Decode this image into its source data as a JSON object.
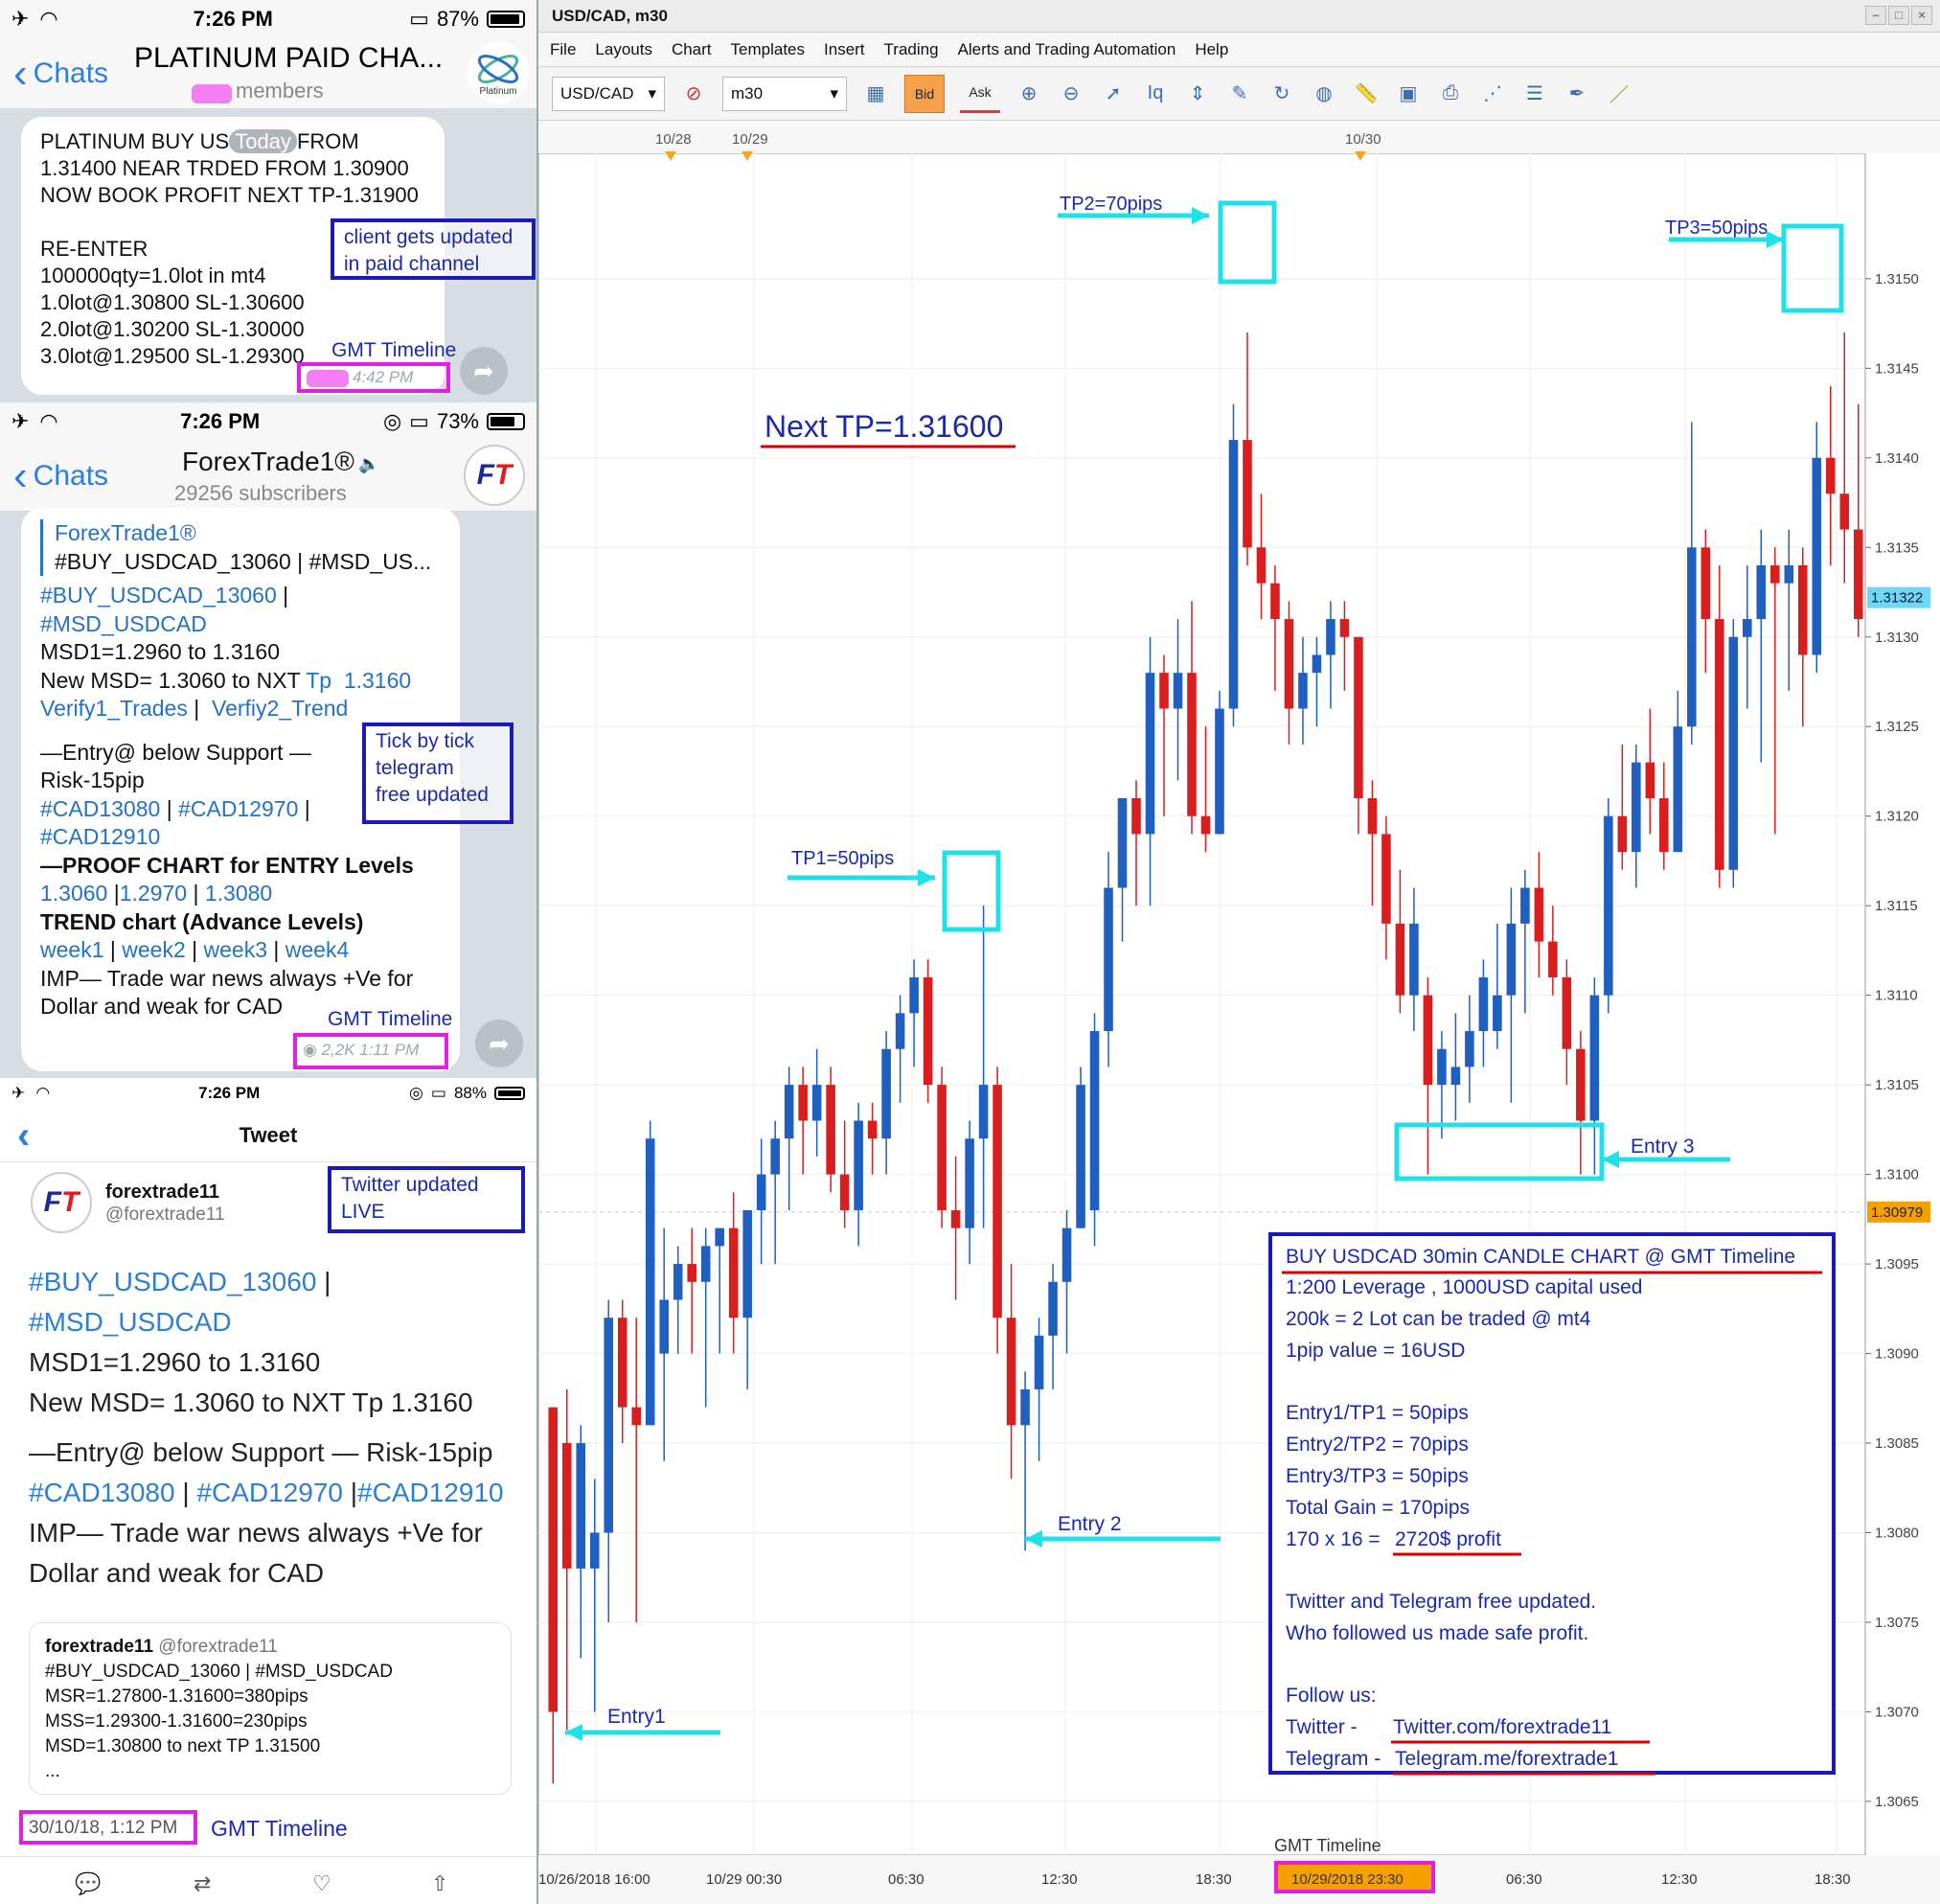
{
  "phone1": {
    "status": {
      "time": "7:26 PM",
      "battery": "87%",
      "battery_frac": 0.87
    },
    "back_label": "Chats",
    "title": "PLATINUM PAID CHA...",
    "subtitle": "members",
    "today": "Today",
    "message": {
      "line1": "PLATINUM BUY US",
      "line1b": "FROM",
      "line2": "1.31400 NEAR TRDED FROM 1.30900",
      "line3": "NOW BOOK PROFIT NEXT TP-1.31900",
      "line4": "RE-ENTER",
      "line5": "100000qty=1.0lot in mt4",
      "line6": "1.0lot@1.30800 SL-1.30600",
      "line7": "2.0lot@1.30200 SL-1.30000",
      "line8": "3.0lot@1.29500 SL-1.29300",
      "time": "4:42 PM"
    },
    "annot_box": "client gets updated in paid channel",
    "annot_box_l1": "client gets updated",
    "annot_box_l2": "in paid channel",
    "gmt": "GMT Timeline"
  },
  "phone2": {
    "status": {
      "time": "7:26 PM",
      "battery": "73%",
      "battery_frac": 0.73
    },
    "back_label": "Chats",
    "title": "ForexTrade1®",
    "subtitle": "29256 subscribers",
    "logo": "FT",
    "msg": {
      "sender": "ForexTrade1®",
      "quote": "#BUY_USDCAD_13060 | #MSD_US...",
      "l1": "#BUY_USDCAD_13060",
      "l1sep": " |",
      "l2": "#MSD_USDCAD",
      "l3": "MSD1=1.2960 to 1.3160",
      "l4a": "New MSD= 1.3060 to NXT ",
      "l4b": "Tp  1.3160",
      "l5a": "Verify1_Trades",
      "l5sep": " |  ",
      "l5b": "Verfiy2_Trend",
      "l6": "—Entry@ below Support —",
      "l7": "Risk-15pip",
      "l8a": "#CAD13080",
      "l8sep1": " | ",
      "l8b": "#CAD12970",
      "l8sep2": " |",
      "l9": "#CAD12910",
      "l10": "—PROOF CHART for ENTRY Levels",
      "l11a": "1.3060",
      "l11sep1": " |",
      "l11b": "1.2970",
      "l11sep2": " | ",
      "l11c": "1.3080",
      "l12": "TREND chart (Advance Levels)",
      "l13a": "week1",
      "l13b": "week2",
      "l13c": "week3",
      "l13d": "week4",
      "l13sep": " | ",
      "l14": "IMP— Trade war news always +Ve for",
      "l15": "Dollar and weak for CAD",
      "views": "2,2K 1:11 PM"
    },
    "annot_box_l1": "Tick by tick",
    "annot_box_l2": "telegram",
    "annot_box_l3": "free updated",
    "gmt": "GMT Timeline"
  },
  "phone3": {
    "status": {
      "time": "7:26 PM",
      "battery": "88%",
      "battery_frac": 0.88
    },
    "header": "Tweet",
    "name": "forextrade11",
    "handle": "@forextrade11",
    "annot_box_l1": "Twitter updated",
    "annot_box_l2": "LIVE",
    "body": {
      "l1": "#BUY_USDCAD_13060",
      "l1sep": " |",
      "l2": "#MSD_USDCAD",
      "l3": "MSD1=1.2960 to 1.3160",
      "l4": "New MSD= 1.3060 to NXT Tp  1.3160",
      "l5": "—Entry@ below Support — Risk-15pip",
      "l6a": "#CAD13080",
      "l6sep1": " | ",
      "l6b": "#CAD12970",
      "l6sep2": " |",
      "l6c": "#CAD12910",
      "l7": "IMP— Trade war news always +Ve for",
      "l8": "Dollar and weak for CAD"
    },
    "quote": {
      "name": "forextrade11",
      "handle": "@forextrade11",
      "l1": "#BUY_USDCAD_13060 | #MSD_USDCAD",
      "l2": "MSR=1.27800-1.31600=380pips",
      "l3": "MSS=1.29300-1.31600=230pips",
      "l4": "MSD=1.30800 to next TP 1.31500",
      "l5": "..."
    },
    "date": "30/10/18, 1:12 PM",
    "gmt": "GMT Timeline"
  },
  "platform": {
    "title": "USD/CAD, m30",
    "menu": [
      "File",
      "Layouts",
      "Chart",
      "Templates",
      "Insert",
      "Trading",
      "Alerts and Trading Automation",
      "Help"
    ],
    "symbol": "USD/CAD",
    "timeframe": "m30",
    "bid": "Bid",
    "ask": "Ask"
  },
  "chart_data": {
    "type": "candlestick",
    "title": "",
    "xlabel": "",
    "ylabel": "",
    "ylim": [
      1.3062,
      1.3157
    ],
    "y_ticks": [
      "1.3150",
      "1.3145",
      "1.3140",
      "1.3135",
      "1.3130",
      "1.3125",
      "1.3120",
      "1.3115",
      "1.3110",
      "1.3105",
      "1.3100",
      "1.3095",
      "1.3090",
      "1.3085",
      "1.3080",
      "1.3075",
      "1.3070",
      "1.3065"
    ],
    "x_ticks": [
      "10/26/2018 16:00",
      "10/29 00:30",
      "06:30",
      "12:30",
      "18:30",
      "10/29/2018 23:30",
      "06:30",
      "12:30",
      "18:30"
    ],
    "top_dates": [
      "10/28",
      "10/29",
      "10/30"
    ],
    "current_price": "1.31322",
    "line_price": "1.30979",
    "candles": [
      [
        1.3087,
        1.3087,
        1.3066,
        1.307
      ],
      [
        1.3085,
        1.3088,
        1.3069,
        1.3078
      ],
      [
        1.3078,
        1.3086,
        1.3073,
        1.3085
      ],
      [
        1.3078,
        1.3083,
        1.307,
        1.308
      ],
      [
        1.308,
        1.3093,
        1.3075,
        1.3092
      ],
      [
        1.3092,
        1.3093,
        1.3085,
        1.3087
      ],
      [
        1.3087,
        1.3092,
        1.3075,
        1.3086
      ],
      [
        1.3086,
        1.3103,
        1.3086,
        1.3102
      ],
      [
        1.309,
        1.3097,
        1.3084,
        1.3093
      ],
      [
        1.3093,
        1.3096,
        1.309,
        1.3095
      ],
      [
        1.3095,
        1.3097,
        1.309,
        1.3094
      ],
      [
        1.3094,
        1.3097,
        1.3087,
        1.3096
      ],
      [
        1.3096,
        1.3097,
        1.309,
        1.3097
      ],
      [
        1.3097,
        1.3099,
        1.309,
        1.3092
      ],
      [
        1.3092,
        1.3098,
        1.3088,
        1.3098
      ],
      [
        1.3098,
        1.3102,
        1.3095,
        1.31
      ],
      [
        1.31,
        1.3103,
        1.3095,
        1.3102
      ],
      [
        1.3102,
        1.3106,
        1.3098,
        1.3105
      ],
      [
        1.3105,
        1.3106,
        1.31,
        1.3103
      ],
      [
        1.3103,
        1.3107,
        1.3101,
        1.3105
      ],
      [
        1.3105,
        1.3106,
        1.3099,
        1.31
      ],
      [
        1.31,
        1.3103,
        1.3097,
        1.3098
      ],
      [
        1.3098,
        1.3104,
        1.3096,
        1.3103
      ],
      [
        1.3103,
        1.3104,
        1.31,
        1.3102
      ],
      [
        1.3102,
        1.3108,
        1.31,
        1.3107
      ],
      [
        1.3107,
        1.311,
        1.3104,
        1.3109
      ],
      [
        1.3109,
        1.3112,
        1.3106,
        1.3111
      ],
      [
        1.3111,
        1.3112,
        1.3104,
        1.3105
      ],
      [
        1.3105,
        1.3106,
        1.3097,
        1.3098
      ],
      [
        1.3098,
        1.3101,
        1.3093,
        1.3097
      ],
      [
        1.3097,
        1.3103,
        1.3095,
        1.3102
      ],
      [
        1.3102,
        1.3115,
        1.3097,
        1.3105
      ],
      [
        1.3105,
        1.3106,
        1.309,
        1.3092
      ],
      [
        1.3092,
        1.3095,
        1.3083,
        1.3086
      ],
      [
        1.3086,
        1.3089,
        1.3079,
        1.3088
      ],
      [
        1.3088,
        1.3092,
        1.3084,
        1.3091
      ],
      [
        1.3091,
        1.3095,
        1.3088,
        1.3094
      ],
      [
        1.3094,
        1.3098,
        1.309,
        1.3097
      ],
      [
        1.3097,
        1.3106,
        1.3097,
        1.3105
      ],
      [
        1.3098,
        1.3109,
        1.3096,
        1.3108
      ],
      [
        1.3108,
        1.3118,
        1.3106,
        1.3116
      ],
      [
        1.3116,
        1.3121,
        1.3113,
        1.3121
      ],
      [
        1.3121,
        1.3122,
        1.3115,
        1.3119
      ],
      [
        1.3119,
        1.313,
        1.3115,
        1.3128
      ],
      [
        1.3128,
        1.3129,
        1.312,
        1.3126
      ],
      [
        1.3126,
        1.3131,
        1.3122,
        1.3128
      ],
      [
        1.3128,
        1.3132,
        1.3119,
        1.312
      ],
      [
        1.312,
        1.3125,
        1.3118,
        1.3119
      ],
      [
        1.3119,
        1.3127,
        1.3119,
        1.3126
      ],
      [
        1.3126,
        1.3143,
        1.3125,
        1.3141
      ],
      [
        1.3141,
        1.3147,
        1.3134,
        1.3135
      ],
      [
        1.3135,
        1.3138,
        1.3131,
        1.3133
      ],
      [
        1.3133,
        1.3134,
        1.3127,
        1.3131
      ],
      [
        1.3131,
        1.3132,
        1.3124,
        1.3126
      ],
      [
        1.3126,
        1.313,
        1.3124,
        1.3128
      ],
      [
        1.3128,
        1.313,
        1.3125,
        1.3129
      ],
      [
        1.3129,
        1.3132,
        1.3126,
        1.3131
      ],
      [
        1.3131,
        1.3132,
        1.3127,
        1.313
      ],
      [
        1.313,
        1.313,
        1.3119,
        1.3121
      ],
      [
        1.3121,
        1.3122,
        1.3115,
        1.3119
      ],
      [
        1.3119,
        1.312,
        1.3112,
        1.3114
      ],
      [
        1.3114,
        1.3117,
        1.3109,
        1.311
      ],
      [
        1.311,
        1.3116,
        1.3108,
        1.3114
      ],
      [
        1.311,
        1.3111,
        1.31,
        1.3105
      ],
      [
        1.3105,
        1.3108,
        1.3102,
        1.3107
      ],
      [
        1.3105,
        1.3109,
        1.3103,
        1.3106
      ],
      [
        1.3106,
        1.311,
        1.3104,
        1.3108
      ],
      [
        1.3108,
        1.3112,
        1.3106,
        1.3111
      ],
      [
        1.3108,
        1.3114,
        1.3107,
        1.311
      ],
      [
        1.311,
        1.3116,
        1.3104,
        1.3114
      ],
      [
        1.3114,
        1.3117,
        1.3109,
        1.3116
      ],
      [
        1.3116,
        1.3118,
        1.3111,
        1.3113
      ],
      [
        1.3113,
        1.3115,
        1.311,
        1.3111
      ],
      [
        1.3111,
        1.3112,
        1.3105,
        1.3107
      ],
      [
        1.3107,
        1.3108,
        1.31,
        1.3103
      ],
      [
        1.3103,
        1.3111,
        1.31,
        1.311
      ],
      [
        1.311,
        1.3121,
        1.3109,
        1.312
      ],
      [
        1.312,
        1.3124,
        1.3117,
        1.3118
      ],
      [
        1.3118,
        1.3124,
        1.3116,
        1.3123
      ],
      [
        1.3123,
        1.3126,
        1.3119,
        1.3121
      ],
      [
        1.3121,
        1.3123,
        1.3117,
        1.3118
      ],
      [
        1.3118,
        1.3127,
        1.3118,
        1.3125
      ],
      [
        1.3125,
        1.3142,
        1.3124,
        1.3135
      ],
      [
        1.3135,
        1.3136,
        1.3128,
        1.3131
      ],
      [
        1.3131,
        1.3134,
        1.3116,
        1.3117
      ],
      [
        1.3117,
        1.3131,
        1.3116,
        1.313
      ],
      [
        1.313,
        1.3134,
        1.3126,
        1.3131
      ],
      [
        1.3131,
        1.3136,
        1.3123,
        1.3134
      ],
      [
        1.3134,
        1.3135,
        1.3119,
        1.3133
      ],
      [
        1.3133,
        1.3136,
        1.3127,
        1.3134
      ],
      [
        1.3134,
        1.3135,
        1.3125,
        1.3129
      ],
      [
        1.3129,
        1.3142,
        1.3128,
        1.314
      ],
      [
        1.314,
        1.3144,
        1.3134,
        1.3138
      ],
      [
        1.3138,
        1.3147,
        1.3133,
        1.3136
      ],
      [
        1.3136,
        1.3143,
        1.313,
        1.3131
      ]
    ]
  },
  "annotations": {
    "next_tp": "Next TP=1.31600",
    "tp1": "TP1=50pips",
    "tp2": "TP2=70pips",
    "tp3": "TP3=50pips",
    "entry1": "Entry1",
    "entry2": "Entry 2",
    "entry3": "Entry 3",
    "gmt": "GMT Timeline",
    "summary": {
      "title": "BUY USDCAD 30min CANDLE CHART @ GMT Timeline",
      "l1": "1:200 Leverage , 1000USD capital used",
      "l2": "200k = 2 Lot can be traded @ mt4",
      "l3": "1pip value = 16USD",
      "l4": "Entry1/TP1 = 50pips",
      "l5": "Entry2/TP2 = 70pips",
      "l6": "Entry3/TP3 = 50pips",
      "l7": "Total Gain = 170pips",
      "l8a": "170 x 16 = ",
      "l8b": "2720$ profit",
      "l9": "Twitter and Telegram free updated.",
      "l10": "Who followed us made safe profit.",
      "l11": "Follow us:",
      "l12a": "Twitter    - ",
      "l12b": "Twitter.com/forextrade11",
      "l13a": "Telegram - ",
      "l13b": "Telegram.me/forextrade1"
    }
  },
  "colors": {
    "bull": "#1e5fbf",
    "bear": "#d81e1e",
    "cyan": "#20e0e8",
    "navy": "#1a1ab8",
    "pink": "#e21ee2"
  }
}
